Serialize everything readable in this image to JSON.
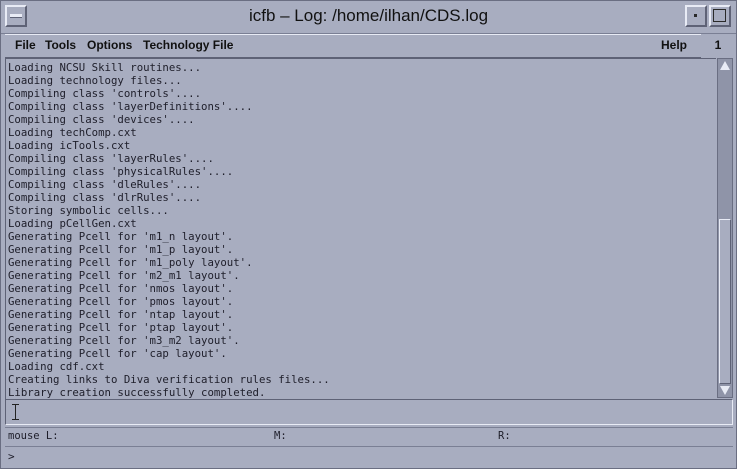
{
  "window": {
    "title": "icfb – Log: /home/ilhan/CDS.log"
  },
  "menubar": {
    "items": [
      "File",
      "Tools",
      "Options",
      "Technology File"
    ],
    "help": "Help",
    "page_number": "1"
  },
  "log": {
    "lines": [
      "Loading NCSU Skill routines...",
      "Loading technology files...",
      "Compiling class 'controls'....",
      "Compiling class 'layerDefinitions'....",
      "Compiling class 'devices'....",
      "Loading techComp.cxt",
      "Loading icTools.cxt",
      "Compiling class 'layerRules'....",
      "Compiling class 'physicalRules'....",
      "Compiling class 'dleRules'....",
      "Compiling class 'dlrRules'....",
      "Storing symbolic cells...",
      "Loading pCellGen.cxt",
      "Generating Pcell for 'm1_n layout'.",
      "Generating Pcell for 'm1_p layout'.",
      "Generating Pcell for 'm1_poly layout'.",
      "Generating Pcell for 'm2_m1 layout'.",
      "Generating Pcell for 'nmos layout'.",
      "Generating Pcell for 'pmos layout'.",
      "Generating Pcell for 'ntap layout'.",
      "Generating Pcell for 'ptap layout'.",
      "Generating Pcell for 'm3_m2 layout'.",
      "Generating Pcell for 'cap layout'.",
      "Loading cdf.cxt",
      "Creating links to Diva verification rules files...",
      "Library creation successfully completed."
    ]
  },
  "status": {
    "mouse_l": "mouse L:",
    "mouse_m": "M:",
    "mouse_r": "R:"
  },
  "prompt": ">"
}
